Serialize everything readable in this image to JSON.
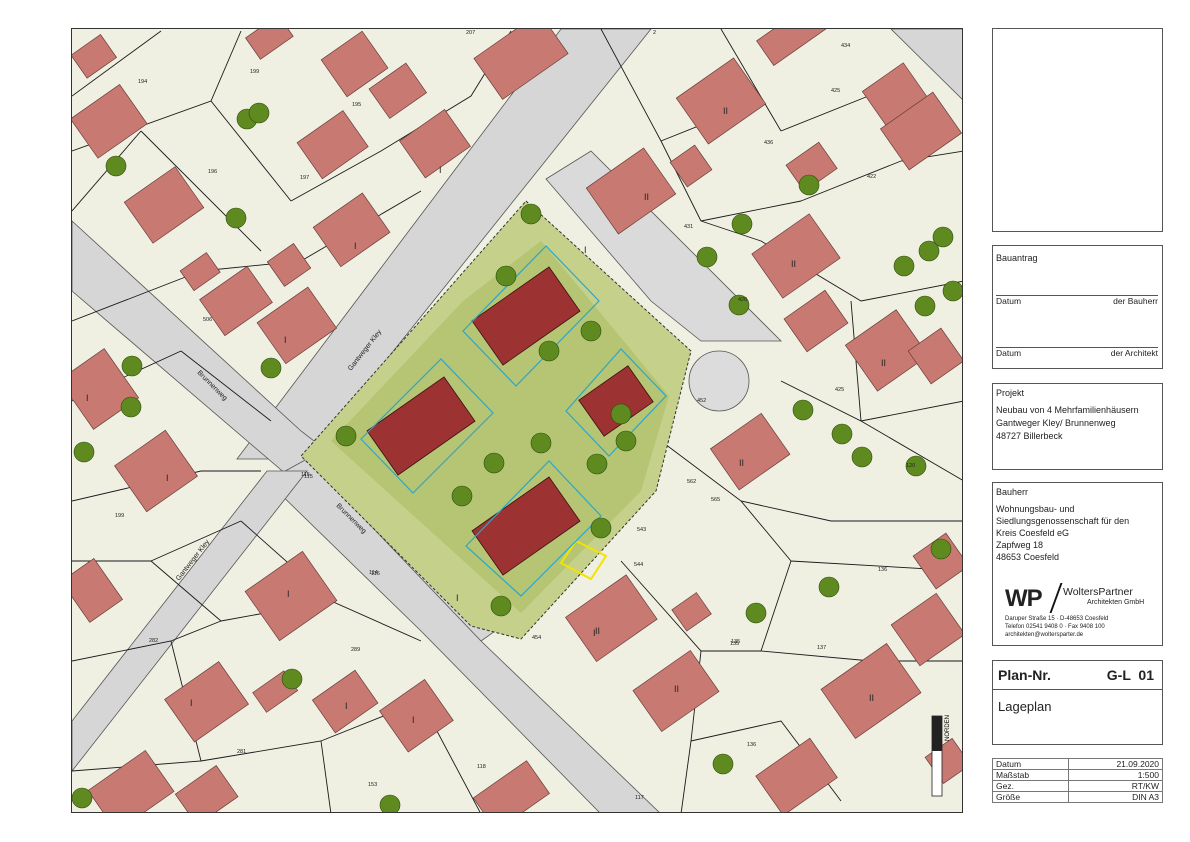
{
  "map": {
    "street_labels": [
      "Gantweger Kley",
      "Brunnenweg",
      "Gantweger Kley",
      "Brunnenweg"
    ],
    "storey_marks": [
      "I",
      "I",
      "I",
      "I",
      "I",
      "I",
      "I",
      "I",
      "I",
      "I",
      "I",
      "I",
      "II",
      "II",
      "II",
      "II",
      "II",
      "II",
      "II",
      "II"
    ],
    "parcel_numbers": [
      "207",
      "2",
      "434",
      "194",
      "199",
      "425",
      "195",
      "436",
      "196",
      "197",
      "431",
      "422",
      "506",
      "115",
      "114",
      "426",
      "425",
      "120",
      "565",
      "136",
      "562",
      "544",
      "135",
      "137",
      "282",
      "199",
      "289",
      "281",
      "153",
      "135",
      "136",
      "117",
      "454",
      "452",
      "543",
      "115",
      "116",
      "118"
    ],
    "north_label": "NORDEN",
    "colors": {
      "paper": "#efefe2",
      "road": "#d6d6d6",
      "building": "#c87a72",
      "building_new": "#9c3232",
      "tree": "#5e8a1f",
      "site": "#c5d18a",
      "line": "#1a1a1a",
      "water": "#2aa7c9"
    }
  },
  "title_block": {
    "bauantrag_label": "Bauantrag",
    "datum_label_1": "Datum",
    "bauherr_sign_label": "der Bauherr",
    "datum_label_2": "Datum",
    "architekt_sign_label": "der Architekt",
    "projekt_label": "Projekt",
    "projekt_lines": [
      "Neubau von 4 Mehrfamilienhäusern",
      "Gantweger Kley/ Brunnenweg",
      "48727 Billerbeck"
    ],
    "bauherr_label": "Bauherr",
    "bauherr_lines": [
      "Wohnungsbau- und",
      "Siedlungsgenossenschaft für den",
      "Kreis Coesfeld eG",
      "Zapfweg 18",
      "48653 Coesfeld"
    ],
    "logo": {
      "mark": "WP",
      "name": "WoltersPartner",
      "sub": "Architekten GmbH",
      "address_lines": [
        "Daruper Straße 15  ·  D-48653 Coesfeld",
        "Telefon 02541 9408 0  ·  Fax 9408 100",
        "architekten@woltersparter.de"
      ]
    },
    "plan_nr_label": "Plan-Nr.",
    "plan_nr_value": "G-L  01",
    "plan_title": "Lageplan",
    "info": [
      {
        "label": "Datum",
        "value": "21.09.2020"
      },
      {
        "label": "Maßstab",
        "value": "1:500"
      },
      {
        "label": "Gez.",
        "value": "RT/KW"
      },
      {
        "label": "Größe",
        "value": "DIN A3"
      }
    ]
  }
}
